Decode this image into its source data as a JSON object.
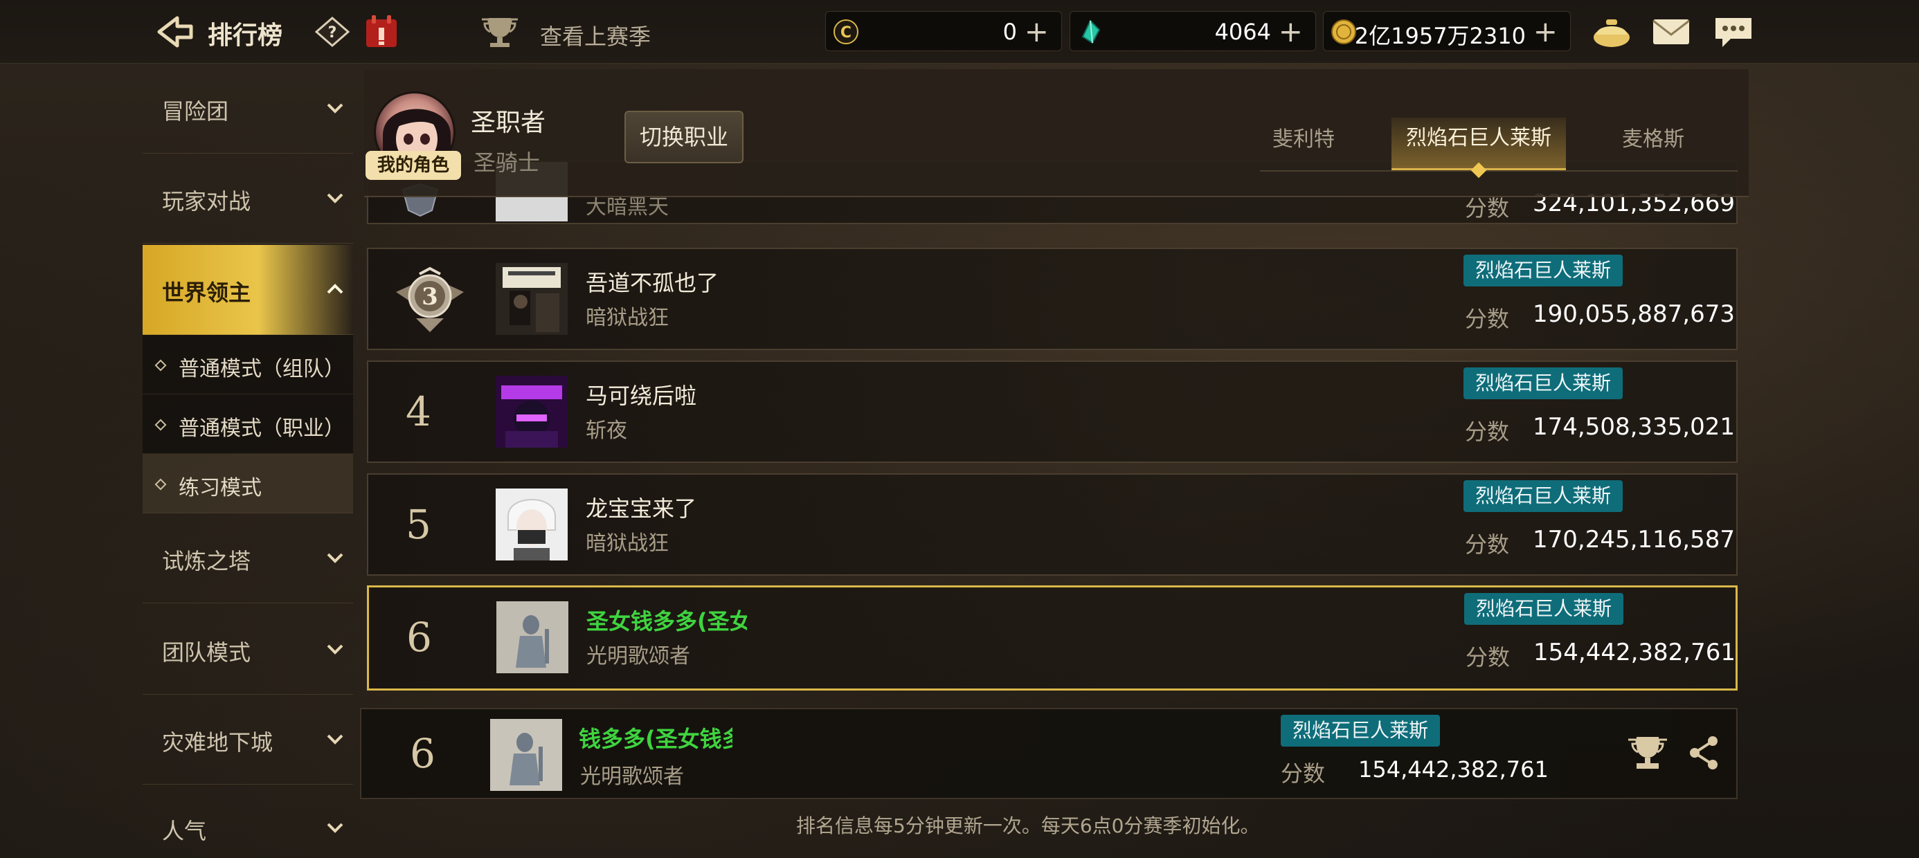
{
  "topbar": {
    "title": "排行榜",
    "last_season": "查看上赛季",
    "currencies": [
      {
        "icon": "c-coin-icon",
        "value": "0",
        "plus": "+"
      },
      {
        "icon": "crystal-icon",
        "value": "4064",
        "plus": "+"
      },
      {
        "icon": "gold-coin-icon",
        "value": "2亿1957万2310",
        "plus": "+"
      }
    ]
  },
  "sidebar": {
    "items": [
      {
        "label": "冒险团"
      },
      {
        "label": "玩家对战"
      },
      {
        "label": "世界领主"
      },
      {
        "label": "试炼之塔"
      },
      {
        "label": "团队模式"
      },
      {
        "label": "灾难地下城"
      },
      {
        "label": "人气"
      }
    ],
    "sub_items": [
      {
        "label": "普通模式（组队）"
      },
      {
        "label": "普通模式（职业）"
      },
      {
        "label": "练习模式"
      }
    ]
  },
  "header": {
    "badge": "我的角色",
    "char_name": "圣职者",
    "char_class": "圣骑士",
    "switch_button": "切换职业",
    "server_tabs": [
      "斐利特",
      "烈焰石巨人莱斯",
      "麦格斯"
    ]
  },
  "partial_row": {
    "name": "大暗黑天",
    "score_label": "分数",
    "score": "324,101,352,669"
  },
  "rows": [
    {
      "rank": "3",
      "name": "吾道不孤也了",
      "class": "暗狱战狂",
      "server": "烈焰石巨人莱斯",
      "score_label": "分数",
      "score": "190,055,887,673"
    },
    {
      "rank": "4",
      "name": "马可绕后啦",
      "class": "斩夜",
      "server": "烈焰石巨人莱斯",
      "score_label": "分数",
      "score": "174,508,335,021"
    },
    {
      "rank": "5",
      "name": "龙宝宝来了",
      "class": "暗狱战狂",
      "server": "烈焰石巨人莱斯",
      "score_label": "分数",
      "score": "170,245,116,587"
    },
    {
      "rank": "6",
      "name": "圣女钱多多(圣女",
      "class": "光明歌颂者",
      "server": "烈焰石巨人莱斯",
      "score_label": "分数",
      "score": "154,442,382,761"
    }
  ],
  "my_row": {
    "rank": "6",
    "name": "钱多多(圣女钱多多",
    "class": "光明歌颂者",
    "server": "烈焰石巨人莱斯",
    "score_label": "分数",
    "score": "154,442,382,761"
  },
  "footer": "排名信息每5分钟更新一次。每天6点0分赛季初始化。",
  "colors": {
    "accent_gold": "#d9b84a",
    "server_badge": "#0f6d7a",
    "my_name_green": "#3fd43f"
  }
}
